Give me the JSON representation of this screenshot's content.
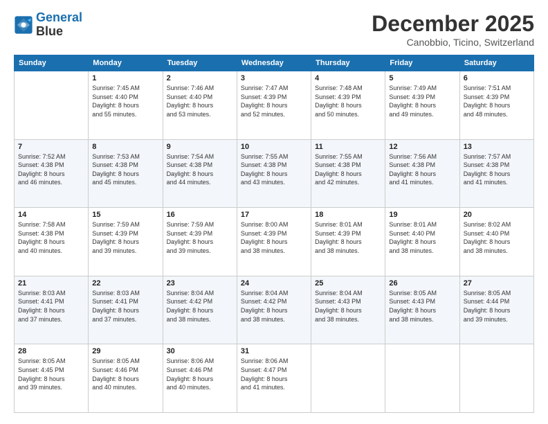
{
  "header": {
    "logo_line1": "General",
    "logo_line2": "Blue",
    "month": "December 2025",
    "location": "Canobbio, Ticino, Switzerland"
  },
  "days_of_week": [
    "Sunday",
    "Monday",
    "Tuesday",
    "Wednesday",
    "Thursday",
    "Friday",
    "Saturday"
  ],
  "weeks": [
    [
      {
        "day": "",
        "info": ""
      },
      {
        "day": "1",
        "info": "Sunrise: 7:45 AM\nSunset: 4:40 PM\nDaylight: 8 hours\nand 55 minutes."
      },
      {
        "day": "2",
        "info": "Sunrise: 7:46 AM\nSunset: 4:40 PM\nDaylight: 8 hours\nand 53 minutes."
      },
      {
        "day": "3",
        "info": "Sunrise: 7:47 AM\nSunset: 4:39 PM\nDaylight: 8 hours\nand 52 minutes."
      },
      {
        "day": "4",
        "info": "Sunrise: 7:48 AM\nSunset: 4:39 PM\nDaylight: 8 hours\nand 50 minutes."
      },
      {
        "day": "5",
        "info": "Sunrise: 7:49 AM\nSunset: 4:39 PM\nDaylight: 8 hours\nand 49 minutes."
      },
      {
        "day": "6",
        "info": "Sunrise: 7:51 AM\nSunset: 4:39 PM\nDaylight: 8 hours\nand 48 minutes."
      }
    ],
    [
      {
        "day": "7",
        "info": "Sunrise: 7:52 AM\nSunset: 4:38 PM\nDaylight: 8 hours\nand 46 minutes."
      },
      {
        "day": "8",
        "info": "Sunrise: 7:53 AM\nSunset: 4:38 PM\nDaylight: 8 hours\nand 45 minutes."
      },
      {
        "day": "9",
        "info": "Sunrise: 7:54 AM\nSunset: 4:38 PM\nDaylight: 8 hours\nand 44 minutes."
      },
      {
        "day": "10",
        "info": "Sunrise: 7:55 AM\nSunset: 4:38 PM\nDaylight: 8 hours\nand 43 minutes."
      },
      {
        "day": "11",
        "info": "Sunrise: 7:55 AM\nSunset: 4:38 PM\nDaylight: 8 hours\nand 42 minutes."
      },
      {
        "day": "12",
        "info": "Sunrise: 7:56 AM\nSunset: 4:38 PM\nDaylight: 8 hours\nand 41 minutes."
      },
      {
        "day": "13",
        "info": "Sunrise: 7:57 AM\nSunset: 4:38 PM\nDaylight: 8 hours\nand 41 minutes."
      }
    ],
    [
      {
        "day": "14",
        "info": "Sunrise: 7:58 AM\nSunset: 4:38 PM\nDaylight: 8 hours\nand 40 minutes."
      },
      {
        "day": "15",
        "info": "Sunrise: 7:59 AM\nSunset: 4:39 PM\nDaylight: 8 hours\nand 39 minutes."
      },
      {
        "day": "16",
        "info": "Sunrise: 7:59 AM\nSunset: 4:39 PM\nDaylight: 8 hours\nand 39 minutes."
      },
      {
        "day": "17",
        "info": "Sunrise: 8:00 AM\nSunset: 4:39 PM\nDaylight: 8 hours\nand 38 minutes."
      },
      {
        "day": "18",
        "info": "Sunrise: 8:01 AM\nSunset: 4:39 PM\nDaylight: 8 hours\nand 38 minutes."
      },
      {
        "day": "19",
        "info": "Sunrise: 8:01 AM\nSunset: 4:40 PM\nDaylight: 8 hours\nand 38 minutes."
      },
      {
        "day": "20",
        "info": "Sunrise: 8:02 AM\nSunset: 4:40 PM\nDaylight: 8 hours\nand 38 minutes."
      }
    ],
    [
      {
        "day": "21",
        "info": "Sunrise: 8:03 AM\nSunset: 4:41 PM\nDaylight: 8 hours\nand 37 minutes."
      },
      {
        "day": "22",
        "info": "Sunrise: 8:03 AM\nSunset: 4:41 PM\nDaylight: 8 hours\nand 37 minutes."
      },
      {
        "day": "23",
        "info": "Sunrise: 8:04 AM\nSunset: 4:42 PM\nDaylight: 8 hours\nand 38 minutes."
      },
      {
        "day": "24",
        "info": "Sunrise: 8:04 AM\nSunset: 4:42 PM\nDaylight: 8 hours\nand 38 minutes."
      },
      {
        "day": "25",
        "info": "Sunrise: 8:04 AM\nSunset: 4:43 PM\nDaylight: 8 hours\nand 38 minutes."
      },
      {
        "day": "26",
        "info": "Sunrise: 8:05 AM\nSunset: 4:43 PM\nDaylight: 8 hours\nand 38 minutes."
      },
      {
        "day": "27",
        "info": "Sunrise: 8:05 AM\nSunset: 4:44 PM\nDaylight: 8 hours\nand 39 minutes."
      }
    ],
    [
      {
        "day": "28",
        "info": "Sunrise: 8:05 AM\nSunset: 4:45 PM\nDaylight: 8 hours\nand 39 minutes."
      },
      {
        "day": "29",
        "info": "Sunrise: 8:05 AM\nSunset: 4:46 PM\nDaylight: 8 hours\nand 40 minutes."
      },
      {
        "day": "30",
        "info": "Sunrise: 8:06 AM\nSunset: 4:46 PM\nDaylight: 8 hours\nand 40 minutes."
      },
      {
        "day": "31",
        "info": "Sunrise: 8:06 AM\nSunset: 4:47 PM\nDaylight: 8 hours\nand 41 minutes."
      },
      {
        "day": "",
        "info": ""
      },
      {
        "day": "",
        "info": ""
      },
      {
        "day": "",
        "info": ""
      }
    ]
  ]
}
